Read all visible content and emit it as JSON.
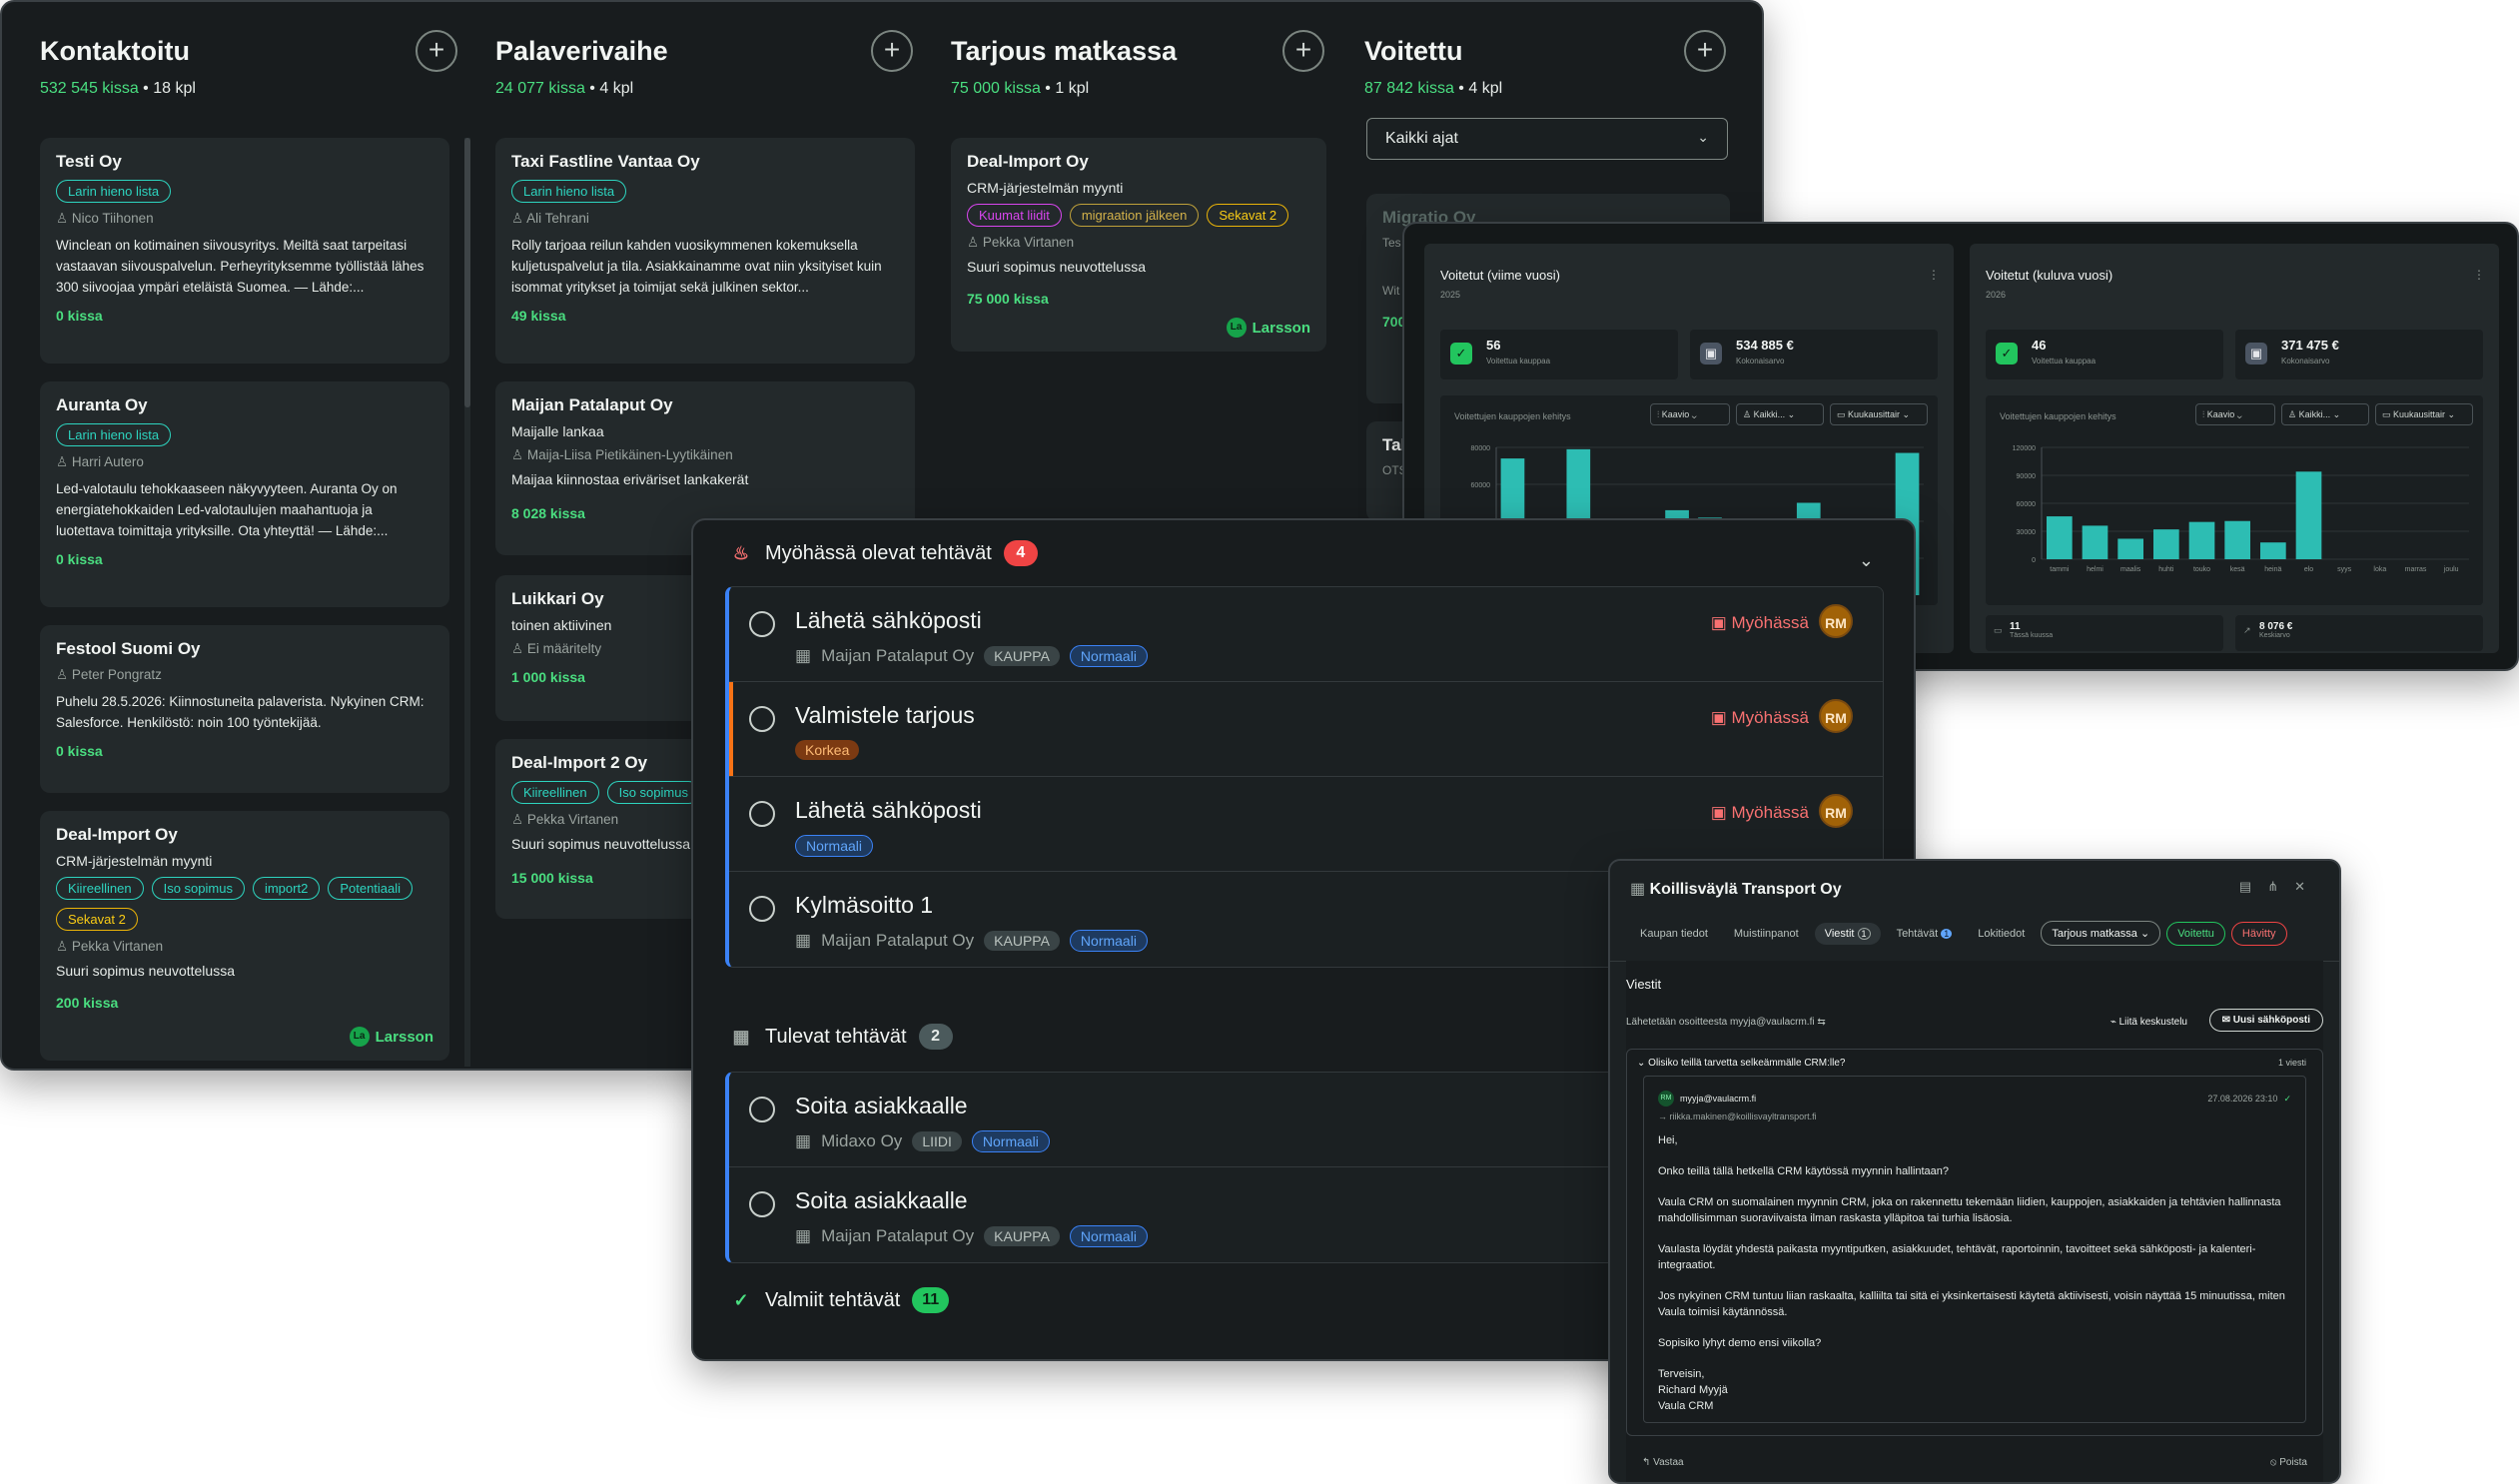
{
  "board": {
    "columns": [
      {
        "title": "Kontaktoitu",
        "amount": "532 545 kissa",
        "count": "18 kpl"
      },
      {
        "title": "Palaverivaihe",
        "amount": "24 077 kissa",
        "count": "4 kpl"
      },
      {
        "title": "Tarjous matkassa",
        "amount": "75 000 kissa",
        "count": "1 kpl"
      },
      {
        "title": "Voitettu",
        "amount": "87 842 kissa",
        "count": "4 kpl"
      }
    ],
    "add_label": "+",
    "period_select": "Kaikki ajat",
    "col1_cards": [
      {
        "title": "Testi Oy",
        "tags": [
          "Larin hieno lista"
        ],
        "person": "Nico Tiihonen",
        "desc": "Winclean on kotimainen siivousyritys. Meiltä saat tarpeitasi vastaavan siivouspalvelun. Perheyrityksemme työllistää lähes 300 siivoojaa ympäri eteläistä Suomea. — Lähde:...",
        "amount": "0 kissa"
      },
      {
        "title": "Auranta Oy",
        "tags": [
          "Larin hieno lista"
        ],
        "person": "Harri Autero",
        "desc": "Led-valotaulu tehokkaaseen näkyvyyteen. Auranta Oy on energiatehokkaiden Led-valotaulujen maahantuoja ja luotettava toimittaja yrityksille. Ota yhteyttä! — Lähde:...",
        "amount": "0 kissa"
      },
      {
        "title": "Festool Suomi Oy",
        "person": "Peter Pongratz",
        "desc": "Puhelu 28.5.2026: Kiinnostuneita palaverista. Nykyinen CRM: Salesforce. Henkilöstö: noin 100 työntekijää.",
        "amount": "0 kissa"
      },
      {
        "title": "Deal-Import Oy",
        "subtitle": "CRM-järjestelmän myynti",
        "tags": [
          "Kiireellinen",
          "Iso sopimus",
          "import2",
          "Potentiaali",
          "Sekavat 2"
        ],
        "person": "Pekka Virtanen",
        "desc": "Suuri sopimus neuvottelussa",
        "amount": "200 kissa",
        "owner_initials": "La",
        "owner": "Larsson"
      }
    ],
    "col2_cards": [
      {
        "title": "Taxi Fastline Vantaa Oy",
        "tags": [
          "Larin hieno lista"
        ],
        "person": "Ali Tehrani",
        "desc": "Rolly tarjoaa reilun kahden vuosikymmenen kokemuksella kuljetuspalvelut ja tila. Asiakkainamme ovat niin yksityiset kuin isommat yritykset ja toimijat sekä julkinen sektor...",
        "amount": "49 kissa"
      },
      {
        "title": "Maijan Patalaput Oy",
        "subtitle": "Maijalle lankaa",
        "person": "Maija-Liisa Pietikäinen-Lyytikäinen",
        "desc": "Maijaa kiinnostaa eriväriset lankakerät",
        "amount": "8 028 kissa"
      },
      {
        "title": "Luikkari Oy",
        "subtitle": "toinen aktiivinen",
        "person": "Ei määritelty",
        "amount": "1 000 kissa"
      },
      {
        "title": "Deal-Import 2 Oy",
        "tags": [
          "Kiireellinen",
          "Iso sopimus"
        ],
        "person": "Pekka Virtanen",
        "desc": "Suuri sopimus neuvottelussa",
        "amount": "15 000 kissa"
      }
    ],
    "col3_cards": [
      {
        "title": "Deal-Import Oy",
        "subtitle": "CRM-järjestelmän myynti",
        "tags": [
          "Kuumat liidit",
          "migraation jälkeen",
          "Sekavat 2"
        ],
        "person": "Pekka Virtanen",
        "desc": "Suuri sopimus neuvottelussa",
        "amount": "75 000 kissa",
        "owner_initials": "La",
        "owner": "Larsson"
      }
    ],
    "col4_peek": {
      "title": "Migratio Oy",
      "line1": "Tes",
      "line2": "Wit",
      "amount": "700",
      "title2": "Tal",
      "line3": "OTS"
    }
  },
  "dashboard": {
    "cards": [
      {
        "title": "Voitetut (viime vuosi)",
        "year": "2025",
        "kpi1_value": "56",
        "kpi1_label": "Voitettua kauppaa",
        "kpi2_value": "534 885 €",
        "kpi2_label": "Kokonaisarvo",
        "chart_title": "Voitettujen kauppojen kehitys",
        "ctrl1": "Kaavio",
        "ctrl2": "Kaikki...",
        "ctrl3": "Kuukausittair"
      },
      {
        "title": "Voitetut (kuluva vuosi)",
        "year": "2026",
        "kpi1_value": "46",
        "kpi1_label": "Voitettua kauppaa",
        "kpi2_value": "371 475 €",
        "kpi2_label": "Kokonaisarvo",
        "chart_title": "Voitettujen kauppojen kehitys",
        "ctrl1": "Kaavio",
        "ctrl2": "Kaikki...",
        "ctrl3": "Kuukausittair",
        "foot1_value": "11",
        "foot1_label": "Tässä kuussa",
        "foot2_value": "8 076 €",
        "foot2_label": "Keskiarvo"
      }
    ]
  },
  "chart_data": [
    {
      "type": "bar",
      "title": "Voitettujen kauppojen kehitys",
      "ylim": [
        0,
        80000
      ],
      "yticks": [
        "80000",
        "60000",
        "40000",
        "20000"
      ],
      "values": [
        74000,
        38000,
        79000,
        30000,
        21000,
        46000,
        42000,
        4000,
        18000,
        50000,
        35000,
        8000,
        77000
      ]
    },
    {
      "type": "bar",
      "title": "Voitettujen kauppojen kehitys",
      "ylim": [
        0,
        120000
      ],
      "yticks": [
        "120000",
        "90000",
        "60000",
        "30000",
        "0"
      ],
      "categories": [
        "tammi",
        "helmi",
        "maalis",
        "huhti",
        "touko",
        "kesä",
        "heinä",
        "elo",
        "syys",
        "loka",
        "marras",
        "joulu"
      ],
      "values": [
        46000,
        36000,
        22000,
        32000,
        40000,
        41000,
        18000,
        94000,
        0,
        0,
        0,
        0
      ]
    }
  ],
  "tasks": {
    "overdue_title": "Myöhässä olevat tehtävät",
    "overdue_count": "4",
    "overdue": [
      {
        "title": "Lähetä sähköposti",
        "company": "Maijan Patalaput Oy",
        "tag": "KAUPPA",
        "priority": "Normaali",
        "status": "Myöhässä",
        "assignee": "RM"
      },
      {
        "title": "Valmistele tarjous",
        "priority": "Korkea",
        "status": "Myöhässä",
        "assignee": "RM"
      },
      {
        "title": "Lähetä sähköposti",
        "priority": "Normaali",
        "status": "Myöhässä",
        "assignee": "RM"
      },
      {
        "title": "Kylmäsoitto 1",
        "company": "Maijan Patalaput Oy",
        "tag": "KAUPPA",
        "priority": "Normaali"
      }
    ],
    "upcoming_title": "Tulevat tehtävät",
    "upcoming_count": "2",
    "upcoming": [
      {
        "title": "Soita asiakkaalle",
        "company": "Midaxo Oy",
        "tag": "LIIDI",
        "priority": "Normaali"
      },
      {
        "title": "Soita asiakkaalle",
        "company": "Maijan Patalaput Oy",
        "tag": "KAUPPA",
        "priority": "Normaali"
      }
    ],
    "done_title": "Valmiit tehtävät",
    "done_count": "11"
  },
  "email": {
    "company": "Koillisväylä Transport Oy",
    "tabs": [
      "Kaupan tiedot",
      "Muistiinpanot",
      "Viestit",
      "Tehtävät",
      "Lokitiedot"
    ],
    "tab_badge_viestit": "1",
    "tab_badge_tehtavat": "1",
    "stage": "Tarjous matkassa",
    "won": "Voitettu",
    "lost": "Hävitty",
    "section": "Viestit",
    "sending_from": "Lähetetään osoitteesta myyja@vaulacrm.fi",
    "link_thread": "Liitä keskustelu",
    "new_email": "Uusi sähköposti",
    "subject": "Olisiko teillä tarvetta selkeämmälle CRM:lle?",
    "thread_count": "1 viesti",
    "from_initials": "RM",
    "from": "myyja@vaulacrm.fi",
    "to": "→ riikka.makinen@koillisvayltransport.fi",
    "date": "27.08.2026 23:10",
    "body": [
      "Hei,",
      "Onko teillä tällä hetkellä CRM käytössä myynnin hallintaan?",
      "Vaula CRM on suomalainen myynnin CRM, joka on rakennettu tekemään liidien, kauppojen, asiakkaiden ja tehtävien hallinnasta mahdollisimman suoraviivaista ilman raskasta ylläpitoa tai turhia lisäosia.",
      "Vaulasta löydät yhdestä paikasta myyntiputken, asiakkuudet, tehtävät, raportoinnin, tavoitteet sekä sähköposti- ja kalenteri-integraatiot.",
      "Jos nykyinen CRM tuntuu liian raskaalta, kalliilta tai sitä ei yksinkertaisesti käytetä aktiivisesti, voisin näyttää 15 minuutissa, miten Vaula toimisi käytännössä.",
      "Sopisiko lyhyt demo ensi viikolla?",
      "Terveisin,\nRichard Myyjä\nVaula CRM"
    ],
    "reply": "Vastaa",
    "delete": "Poista"
  }
}
